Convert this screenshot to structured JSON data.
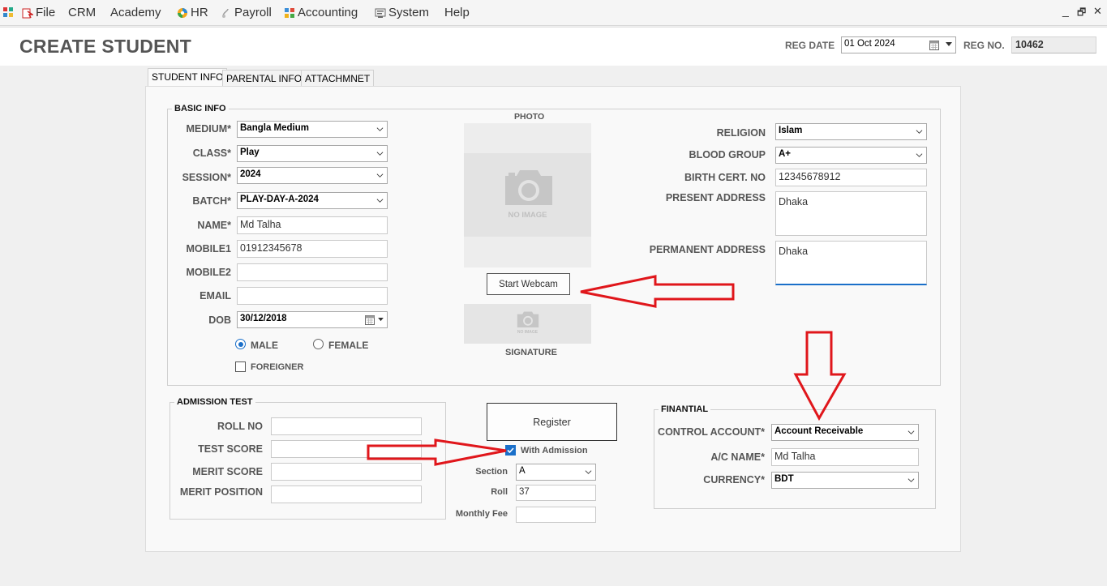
{
  "menu": {
    "items": [
      {
        "label": "File"
      },
      {
        "label": "CRM"
      },
      {
        "label": "Academy"
      },
      {
        "label": "HR"
      },
      {
        "label": "Payroll"
      },
      {
        "label": "Accounting"
      },
      {
        "label": "System"
      },
      {
        "label": "Help"
      }
    ],
    "window_controls": {
      "minimize": "_",
      "restore": "🗗",
      "close": "✕"
    }
  },
  "header": {
    "title": "CREATE STUDENT",
    "reg_date_label": "REG DATE",
    "reg_date_value": "01 Oct 2024",
    "reg_no_label": "REG NO.",
    "reg_no_value": "10462"
  },
  "tabs": [
    {
      "label": "STUDENT INFO",
      "active": true
    },
    {
      "label": "PARENTAL INFO",
      "active": false
    },
    {
      "label": "ATTACHMNET",
      "active": false
    }
  ],
  "basic_info": {
    "title": "BASIC INFO",
    "medium_label": "MEDIUM*",
    "medium_value": "Bangla Medium",
    "class_label": "CLASS*",
    "class_value": "Play",
    "session_label": "SESSION*",
    "session_value": "2024",
    "batch_label": "BATCH*",
    "batch_value": "PLAY-DAY-A-2024",
    "name_label": "NAME*",
    "name_value": "Md Talha",
    "mobile1_label": "MOBILE1",
    "mobile1_value": "01912345678",
    "mobile2_label": "MOBILE2",
    "mobile2_value": "",
    "email_label": "EMAIL",
    "email_value": "",
    "dob_label": "DOB",
    "dob_value": "30/12/2018",
    "gender_male": "MALE",
    "gender_female": "FEMALE",
    "gender_selected": "MALE",
    "foreigner_label": "FOREIGNER",
    "foreigner_checked": false,
    "photo_label": "PHOTO",
    "no_image_text": "NO IMAGE",
    "webcam_button": "Start Webcam",
    "signature_label": "SIGNATURE",
    "religion_label": "RELIGION",
    "religion_value": "Islam",
    "blood_group_label": "BLOOD GROUP",
    "blood_group_value": "A+",
    "birth_cert_label": "BIRTH CERT. NO",
    "birth_cert_value": "12345678912",
    "present_address_label": "PRESENT ADDRESS",
    "present_address_value": "Dhaka",
    "permanent_address_label": "PERMANENT ADDRESS",
    "permanent_address_value": "Dhaka"
  },
  "admission_test": {
    "title": "ADMISSION TEST",
    "roll_no_label": "ROLL NO",
    "test_score_label": "TEST SCORE",
    "merit_score_label": "MERIT SCORE",
    "merit_position_label": "MERIT POSITION"
  },
  "register": {
    "button": "Register",
    "with_admission_label": "With Admission",
    "with_admission_checked": true,
    "section_label": "Section",
    "section_value": "A",
    "roll_label": "Roll",
    "roll_value": "37",
    "monthly_fee_label": "Monthly Fee",
    "monthly_fee_value": ""
  },
  "financial": {
    "title": "FINANTIAL",
    "control_account_label": "CONTROL ACCOUNT*",
    "control_account_value": "Account Receivable",
    "ac_name_label": "A/C NAME*",
    "ac_name_value": "Md Talha",
    "currency_label": "CURRENCY*",
    "currency_value": "BDT"
  },
  "colors": {
    "accent": "#1a6fc9",
    "annotation_arrow": "#e0161b",
    "header_bg": "#ffffff",
    "panel_bg": "#f9f9f9"
  }
}
